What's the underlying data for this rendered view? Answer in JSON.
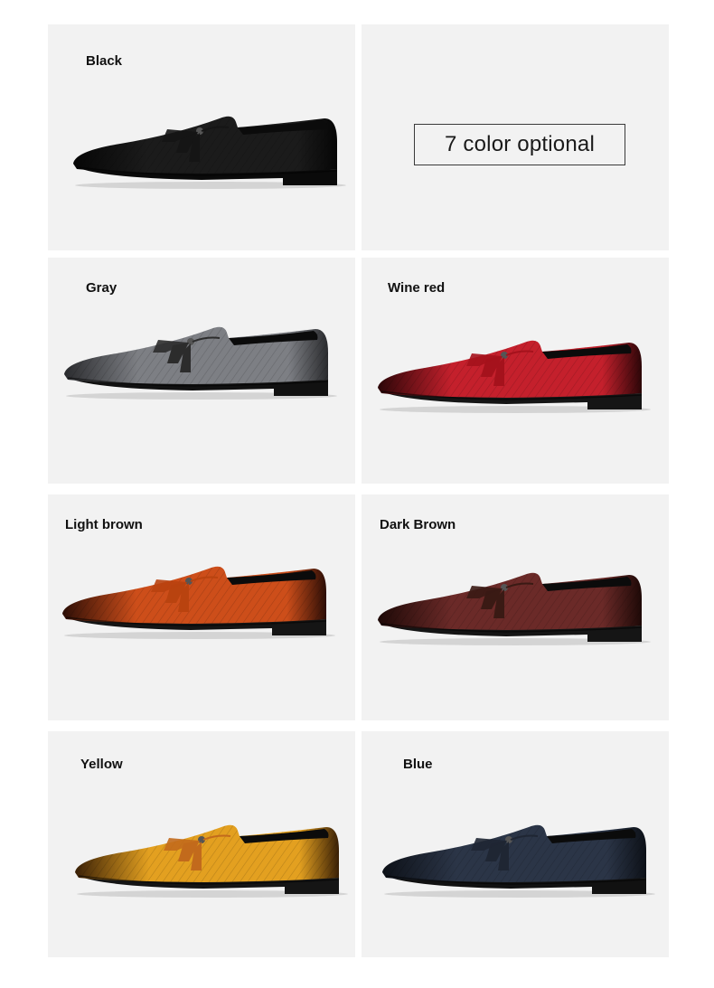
{
  "banner": {
    "text": "7 color optional"
  },
  "variants": [
    {
      "label": "Black",
      "icon": "black-loafer-shoe",
      "upper": "#1b1b1b",
      "toe": "#060606",
      "sole": "#0a0a0a",
      "tassel": "#151515"
    },
    {
      "label": "Gray",
      "icon": "gray-loafer-shoe",
      "upper": "#7d7f84",
      "toe": "#2a2b2e",
      "sole": "#111111",
      "tassel": "#2c2c2c"
    },
    {
      "label": "Wine red",
      "icon": "wine-red-loafer-shoe",
      "upper": "#c4202c",
      "toe": "#2c0608",
      "sole": "#151515",
      "tassel": "#a5121c"
    },
    {
      "label": "Light brown",
      "icon": "light-brown-loafer-shoe",
      "upper": "#cd4e1a",
      "toe": "#2d0e06",
      "sole": "#151515",
      "tassel": "#b9430f"
    },
    {
      "label": "Dark Brown",
      "icon": "dark-brown-loafer-shoe",
      "upper": "#6b2a28",
      "toe": "#1e0907",
      "sole": "#151515",
      "tassel": "#3a1a14"
    },
    {
      "label": "Yellow",
      "icon": "yellow-loafer-shoe",
      "upper": "#e3a020",
      "toe": "#3a2006",
      "sole": "#151515",
      "tassel": "#c26a1c"
    },
    {
      "label": "Blue",
      "icon": "blue-loafer-shoe",
      "upper": "#2b3547",
      "toe": "#0d1118",
      "sole": "#111111",
      "tassel": "#1f2633"
    }
  ]
}
